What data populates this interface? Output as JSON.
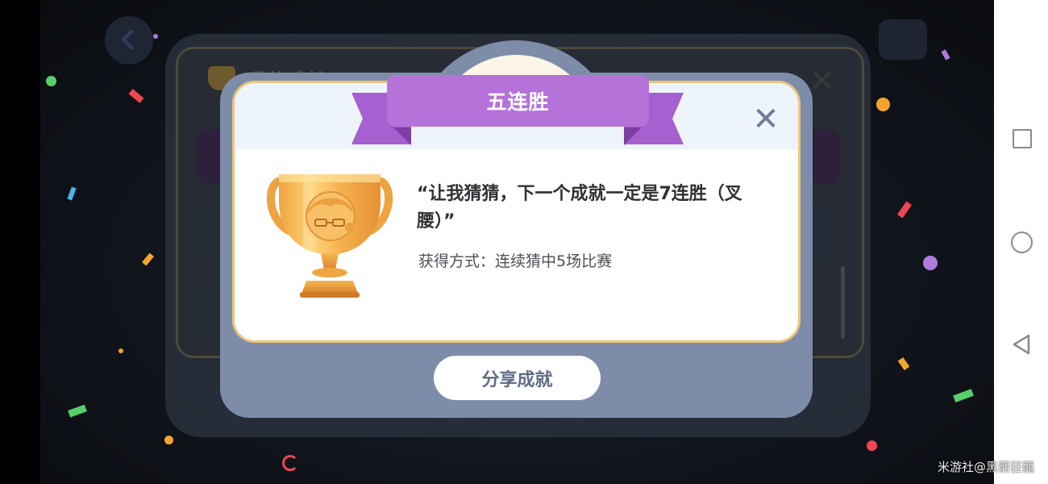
{
  "achievement": {
    "title": "五连胜",
    "quote": "“让我猜猜，下一个成就一定是7连胜（叉腰）”",
    "method": "获得方式：连续猜中5场比赛",
    "share_label": "分享成就",
    "close_symbol": "✕",
    "trophy_icon": "trophy-icon"
  },
  "background": {
    "title": "我的成就",
    "close_symbol": "✕"
  },
  "watermark": "米游社@黑箭狂龍",
  "colors": {
    "ribbon": "#b573da",
    "card_border": "#efc57a",
    "dialog_frame": "#7d8da9",
    "share_text": "#5f6d86"
  }
}
